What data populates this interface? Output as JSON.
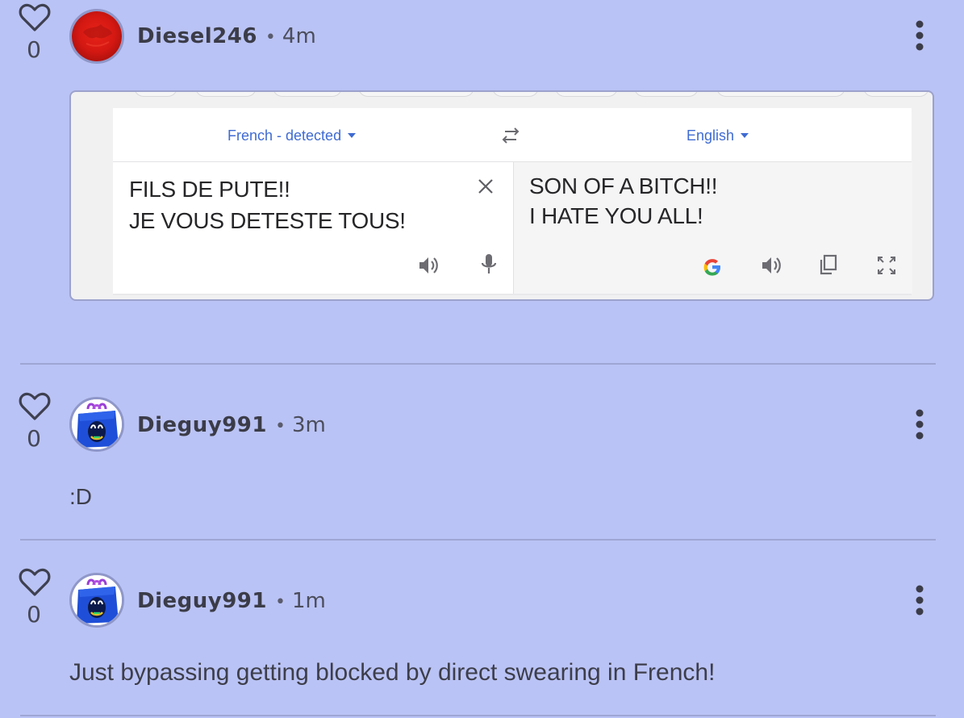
{
  "posts": [
    {
      "likes": "0",
      "username": "Diesel246",
      "separator": "•",
      "time": "4m",
      "attachment": {
        "source_language": "French - detected",
        "target_language": "English",
        "source_lines": [
          "FILS DE PUTE!!",
          "JE VOUS DETESTE TOUS!"
        ],
        "target_lines": [
          "SON OF A BITCH!!",
          "I HATE YOU ALL!"
        ],
        "source_tools": [
          "speaker-icon",
          "microphone-icon"
        ],
        "target_tools": [
          "google-g-icon",
          "speaker-icon",
          "copy-icon",
          "fullscreen-icon"
        ]
      }
    },
    {
      "likes": "0",
      "username": "Dieguy991",
      "separator": "•",
      "time": "3m",
      "text": ":D"
    },
    {
      "likes": "0",
      "username": "Dieguy991",
      "separator": "•",
      "time": "1m",
      "text": "Just bypassing getting blocked by direct swearing in French!"
    }
  ],
  "colors": {
    "background": "#bac3f5",
    "divider": "#9ea6d4",
    "translate_link": "#3f6bd2"
  }
}
